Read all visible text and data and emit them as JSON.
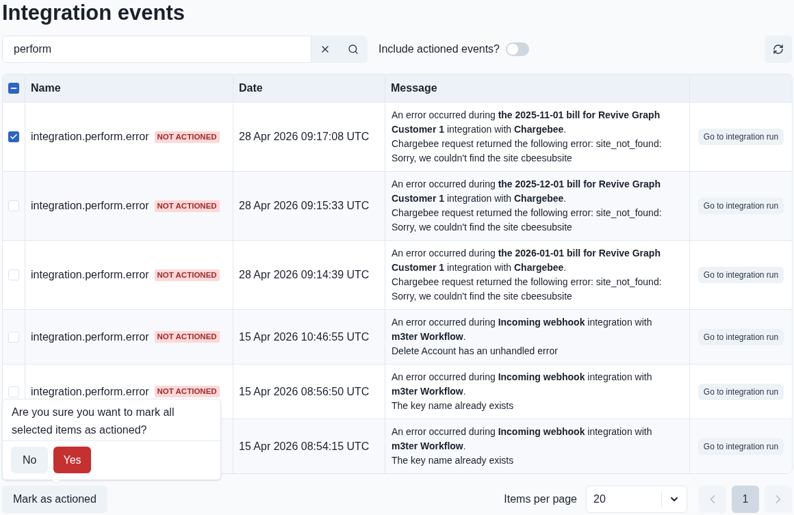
{
  "page": {
    "title": "Integration events"
  },
  "toolbar": {
    "search": {
      "value": "perform"
    },
    "include_actioned": {
      "label": "Include actioned events?",
      "on": false
    }
  },
  "table": {
    "select_all": {
      "indeterminate": true
    },
    "columns": [
      "Name",
      "Date",
      "Message"
    ],
    "rows": [
      {
        "selected": true,
        "name": "integration.perform.error",
        "status": "NOT ACTIONED",
        "date": "28 Apr 2026 09:17:08 UTC",
        "message": "An error occurred during **the 2025-11-01 bill for Revive Graph Customer 1** integration with **Chargebee**.",
        "detail": "Chargebee request returned the following error: site_not_found: Sorry, we couldn't find the site cbeesubsite",
        "action": "Go to integration run"
      },
      {
        "selected": false,
        "name": "integration.perform.error",
        "status": "NOT ACTIONED",
        "date": "28 Apr 2026 09:15:33 UTC",
        "message": "An error occurred during **the 2025-12-01 bill for Revive Graph Customer 1** integration with **Chargebee**.",
        "detail": "Chargebee request returned the following error: site_not_found: Sorry, we couldn't find the site cbeesubsite",
        "action": "Go to integration run"
      },
      {
        "selected": false,
        "name": "integration.perform.error",
        "status": "NOT ACTIONED",
        "date": "28 Apr 2026 09:14:39 UTC",
        "message": "An error occurred during **the 2026-01-01 bill for Revive Graph Customer 1** integration with **Chargebee**.",
        "detail": "Chargebee request returned the following error: site_not_found: Sorry, we couldn't find the site cbeesubsite",
        "action": "Go to integration run"
      },
      {
        "selected": false,
        "name": "integration.perform.error",
        "status": "NOT ACTIONED",
        "date": "15 Apr 2026 10:46:55 UTC",
        "message": "An error occurred during **Incoming webhook** integration with **m3ter Workflow**.",
        "detail": "Delete Account has an unhandled error",
        "action": "Go to integration run"
      },
      {
        "selected": false,
        "name": "integration.perform.error",
        "status": "NOT ACTIONED",
        "date": "15 Apr 2026 08:56:50 UTC",
        "message": "An error occurred during **Incoming webhook** integration with **m3ter Workflow**.",
        "detail": "The key name already exists",
        "action": "Go to integration run"
      },
      {
        "date": "15 Apr 2026 08:54:15 UTC",
        "message": "An error occurred during **Incoming webhook** integration with **m3ter Workflow**.",
        "detail": "The key name already exists",
        "action": "Go to integration run"
      }
    ]
  },
  "confirm_popover": {
    "text": "Are you sure you want to mark all selected items as actioned?",
    "buttons": [
      {
        "label": "No",
        "kind": "secondary"
      },
      {
        "label": "Yes",
        "kind": "danger"
      }
    ]
  },
  "footer": {
    "mark_button": "Mark as actioned",
    "items_per_page": {
      "label": "Items per page",
      "value": "20"
    },
    "pagination": {
      "prev_disabled": true,
      "pages": [
        {
          "label": "1",
          "selected": true
        }
      ],
      "next_disabled": true
    }
  }
}
